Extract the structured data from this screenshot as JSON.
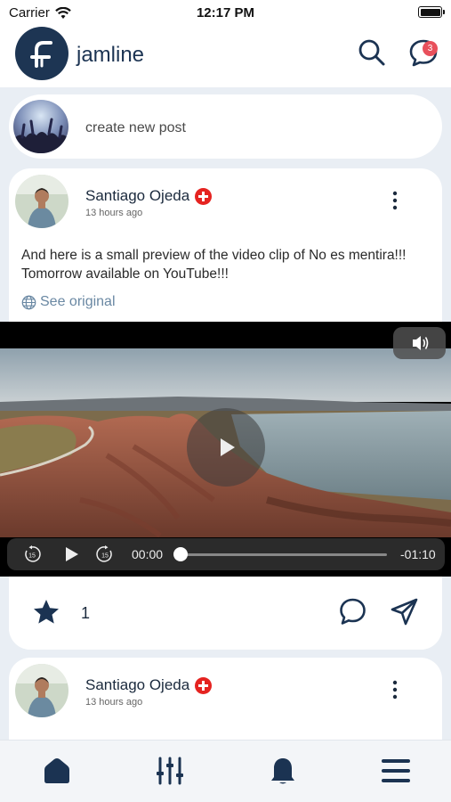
{
  "status_bar": {
    "carrier": "Carrier",
    "time": "12:17 PM"
  },
  "header": {
    "brand": "jamline",
    "icons": {
      "search": "search-icon",
      "messages": "chat-bubble-icon"
    },
    "message_badge": "3"
  },
  "new_post": {
    "label": "create new post"
  },
  "posts": [
    {
      "author": "Santiago Ojeda",
      "time_ago": "13 hours ago",
      "text": "And here is a small preview of the video clip of No es mentira!!! Tomorrow available on YouTube!!!",
      "see_original": "See original",
      "video": {
        "current_time": "00:00",
        "remaining_time": "-01:10",
        "progress": 0
      },
      "likes": "1"
    },
    {
      "author": "Santiago Ojeda",
      "time_ago": "13 hours ago"
    }
  ],
  "tabbar": [
    "home-icon",
    "sliders-icon",
    "bell-icon",
    "menu-icon"
  ],
  "colors": {
    "brand": "#1d3553",
    "badge": "#e8505b",
    "flag": "#e52320",
    "link": "#6a88a3"
  }
}
